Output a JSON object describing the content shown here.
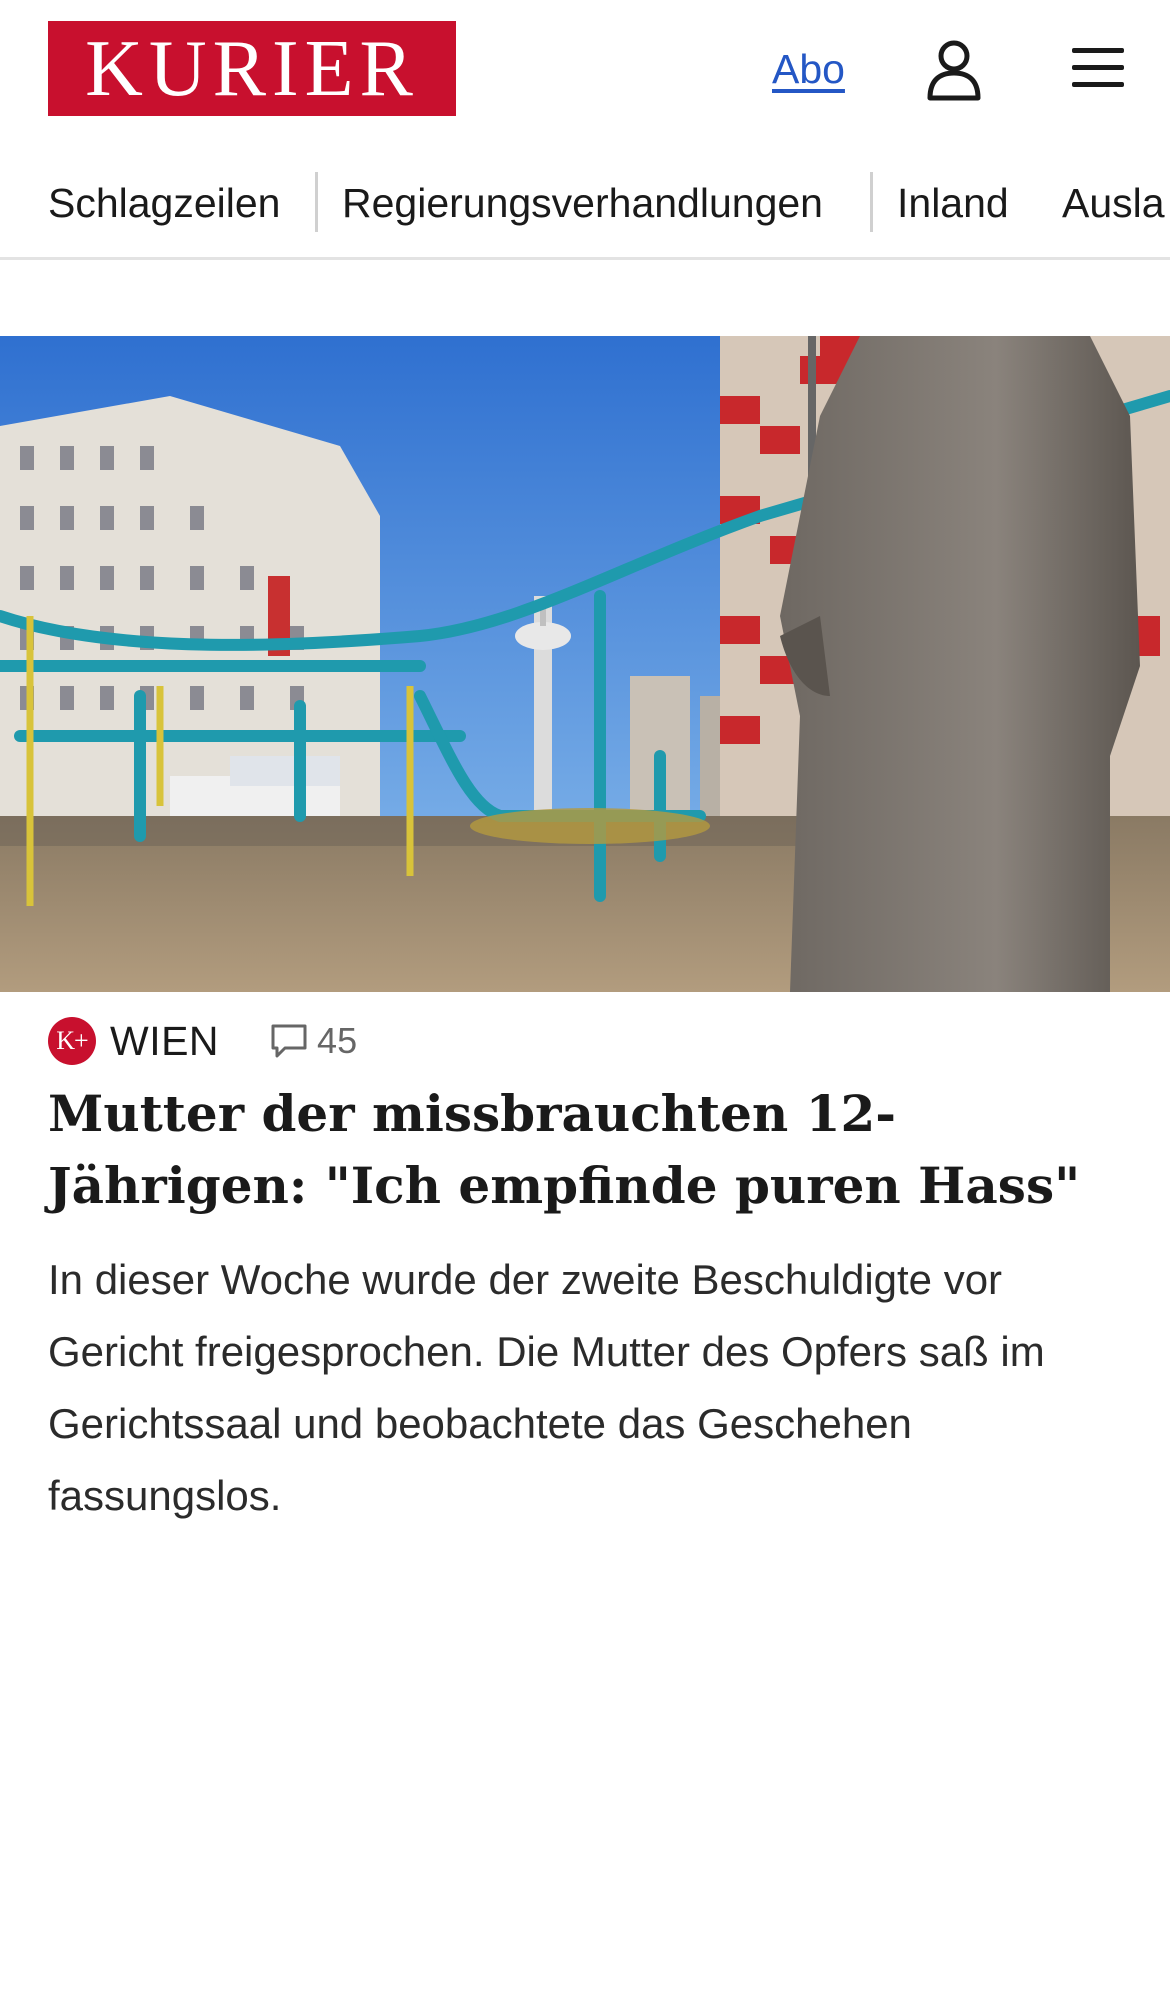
{
  "header": {
    "logo_text": "KURIER",
    "abo_label": "Abo",
    "user_icon": "user-icon",
    "menu_icon": "hamburger-menu-icon"
  },
  "nav": {
    "items": [
      "Schlagzeilen",
      "Regierungsverhandlungen",
      "Inland",
      "Ausla"
    ]
  },
  "article": {
    "badge": "K+",
    "section": "WIEN",
    "comment_count": "45",
    "headline": "Mutter der missbrauchten 12-Jährigen: \"Ich empfinde puren Hass\"",
    "teaser": "In dieser Woche wurde der zweite Beschuldigte vor Gericht freigesprochen. Die Mutter des Opfers saß im Gerichtssaal und beobachtete das Geschehen fassungslos."
  },
  "colors": {
    "brand": "#c8102e",
    "link": "#2457c5"
  }
}
